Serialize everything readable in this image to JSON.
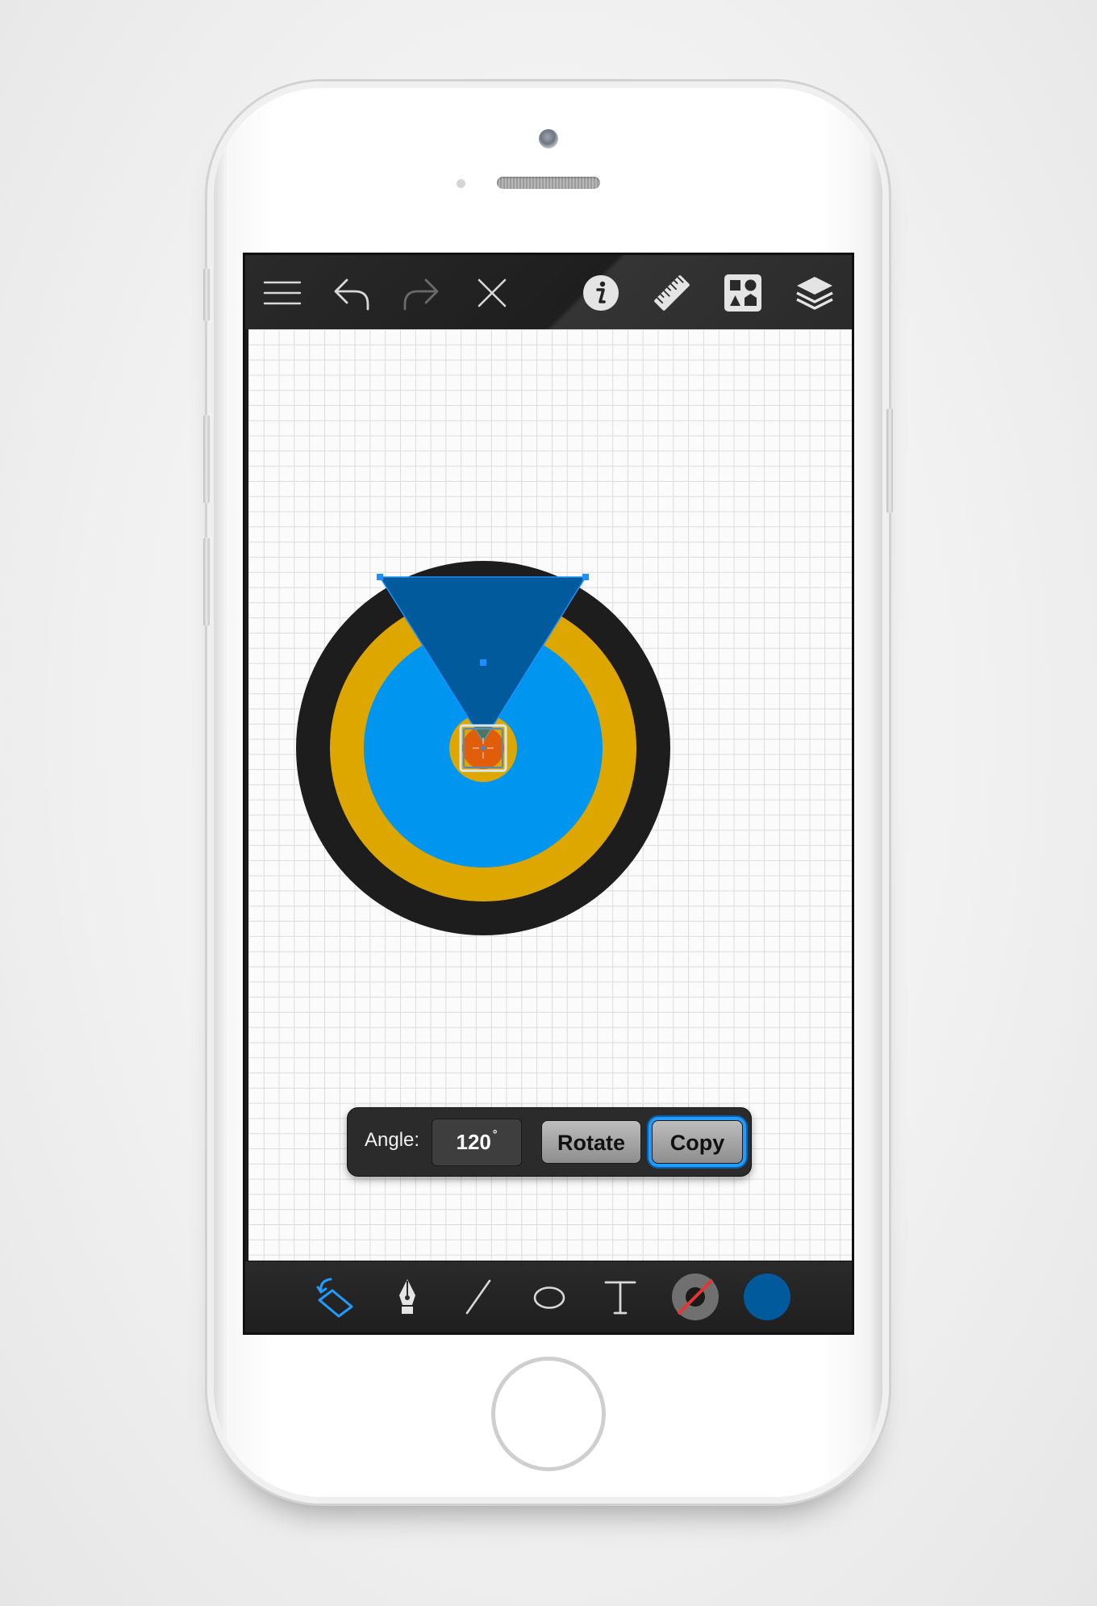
{
  "toolbar": {
    "icons": [
      "menu-icon",
      "undo-icon",
      "redo-icon",
      "close-icon",
      "info-icon",
      "ruler-icon",
      "shapes-library-icon",
      "layers-icon"
    ]
  },
  "rotate_popup": {
    "angle_label": "Angle:",
    "angle_value": "120",
    "angle_unit": "°",
    "rotate_label": "Rotate",
    "copy_label": "Copy"
  },
  "bottom_toolbar": {
    "icons": [
      "transform-tool-icon",
      "pen-tool-icon",
      "line-tool-icon",
      "ellipse-tool-icon",
      "text-tool-icon",
      "stroke-color-icon",
      "fill-color-icon"
    ],
    "fill_color": "#005a9c"
  },
  "drawing": {
    "colors": {
      "outer_ring": "#1d1d1d",
      "gold_ring": "#dea700",
      "blue_disc": "#0096f0",
      "center_red": "#e2380e",
      "triangle": "#005a9c",
      "selection": "#1e8fff"
    }
  }
}
